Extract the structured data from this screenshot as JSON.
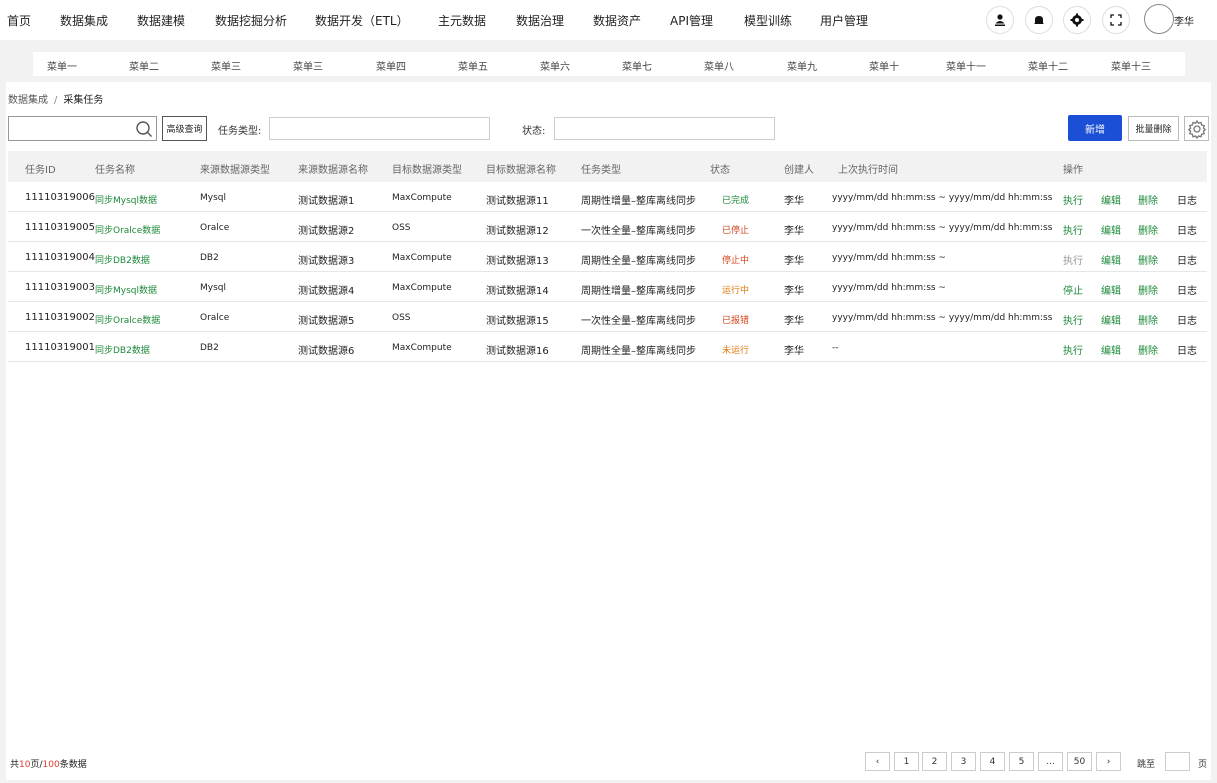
{
  "topnav": {
    "items": [
      "首页",
      "数据集成",
      "数据建模",
      "数据挖掘分析",
      "数据开发（ETL）",
      "主元数据",
      "数据治理",
      "数据资产",
      "API管理",
      "模型训练",
      "用户管理"
    ],
    "user_name": "李华",
    "icons": [
      "user-upload-icon",
      "bell-icon",
      "gear-icon",
      "fullscreen-icon"
    ]
  },
  "submenu": {
    "items": [
      "菜单一",
      "菜单二",
      "菜单三",
      "菜单三",
      "菜单四",
      "菜单五",
      "菜单六",
      "菜单七",
      "菜单八",
      "菜单九",
      "菜单十",
      "菜单十一",
      "菜单十二",
      "菜单十三"
    ]
  },
  "breadcrumb": {
    "parent": "数据集成",
    "separator": "/",
    "current": "采集任务"
  },
  "toolbar": {
    "search_value": "",
    "advanced_label": "高级查询",
    "task_type_label": "任务类型:",
    "task_type_value": "",
    "status_label": "状态:",
    "status_value": "",
    "new_label": "新增",
    "batch_delete_label": "批量删除"
  },
  "table": {
    "headers": [
      "任务ID",
      "任务名称",
      "来源数据源类型",
      "来源数据源名称",
      "目标数据源类型",
      "目标数据源名称",
      "任务类型",
      "状态",
      "创建人",
      "上次执行时间",
      "操作"
    ],
    "rows": [
      {
        "id": "11110319006",
        "name": "同步Mysql数据",
        "src_type": "Mysql",
        "src_name": "测试数据源1",
        "dst_type": "MaxCompute",
        "dst_name": "测试数据源11",
        "task_type": "周期性增量–整库离线同步",
        "status": "已完成",
        "status_kind": "done",
        "creator": "李华",
        "last_run": "yyyy/mm/dd hh:mm:ss ~ yyyy/mm/dd hh:mm:ss",
        "run_label": "执行",
        "run_enabled": true,
        "edit_label": "编辑",
        "delete_label": "删除",
        "log_label": "日志"
      },
      {
        "id": "11110319005",
        "name": "同步Oralce数据",
        "src_type": "Oralce",
        "src_name": "测试数据源2",
        "dst_type": "OSS",
        "dst_name": "测试数据源12",
        "task_type": "一次性全量–整库离线同步",
        "status": "已停止",
        "status_kind": "stop",
        "creator": "李华",
        "last_run": "yyyy/mm/dd hh:mm:ss ~ yyyy/mm/dd hh:mm:ss",
        "run_label": "执行",
        "run_enabled": true,
        "edit_label": "编辑",
        "delete_label": "删除",
        "log_label": "日志"
      },
      {
        "id": "11110319004",
        "name": "同步DB2数据",
        "src_type": "DB2",
        "src_name": "测试数据源3",
        "dst_type": "MaxCompute",
        "dst_name": "测试数据源13",
        "task_type": "周期性全量–整库离线同步",
        "status": "停止中",
        "status_kind": "stop",
        "creator": "李华",
        "last_run": "yyyy/mm/dd hh:mm:ss ~",
        "run_label": "执行",
        "run_enabled": false,
        "edit_label": "编辑",
        "delete_label": "删除",
        "log_label": "日志"
      },
      {
        "id": "11110319003",
        "name": "同步Mysql数据",
        "src_type": "Mysql",
        "src_name": "测试数据源4",
        "dst_type": "MaxCompute",
        "dst_name": "测试数据源14",
        "task_type": "周期性增量–整库离线同步",
        "status": "运行中",
        "status_kind": "run",
        "creator": "李华",
        "last_run": "yyyy/mm/dd hh:mm:ss ~",
        "run_label": "停止",
        "run_enabled": true,
        "edit_label": "编辑",
        "delete_label": "删除",
        "log_label": "日志"
      },
      {
        "id": "11110319002",
        "name": "同步Oralce数据",
        "src_type": "Oralce",
        "src_name": "测试数据源5",
        "dst_type": "OSS",
        "dst_name": "测试数据源15",
        "task_type": "一次性全量–整库离线同步",
        "status": "已报错",
        "status_kind": "err",
        "creator": "李华",
        "last_run": "yyyy/mm/dd hh:mm:ss ~ yyyy/mm/dd hh:mm:ss",
        "run_label": "执行",
        "run_enabled": true,
        "edit_label": "编辑",
        "delete_label": "删除",
        "log_label": "日志"
      },
      {
        "id": "11110319001",
        "name": "同步DB2数据",
        "src_type": "DB2",
        "src_name": "测试数据源6",
        "dst_type": "MaxCompute",
        "dst_name": "测试数据源16",
        "task_type": "周期性全量–整库离线同步",
        "status": "未运行",
        "status_kind": "not",
        "creator": "李华",
        "last_run": "--",
        "run_label": "执行",
        "run_enabled": true,
        "edit_label": "编辑",
        "delete_label": "删除",
        "log_label": "日志"
      }
    ]
  },
  "footer": {
    "total_prefix": "共",
    "total_pages": "10",
    "total_mid": "页/",
    "total_items": "100",
    "total_suffix": "条数据",
    "pages": [
      "‹",
      "1",
      "2",
      "3",
      "4",
      "5",
      "...",
      "50",
      "›"
    ],
    "jump_label": "跳至",
    "jump_value": "",
    "page_unit": "页"
  },
  "colors": {
    "primary": "#1a4fd6",
    "link_green": "#1d8a3a",
    "status_red": "#d0451b",
    "status_orange": "#e07a10",
    "total_red": "#e03c2e"
  }
}
